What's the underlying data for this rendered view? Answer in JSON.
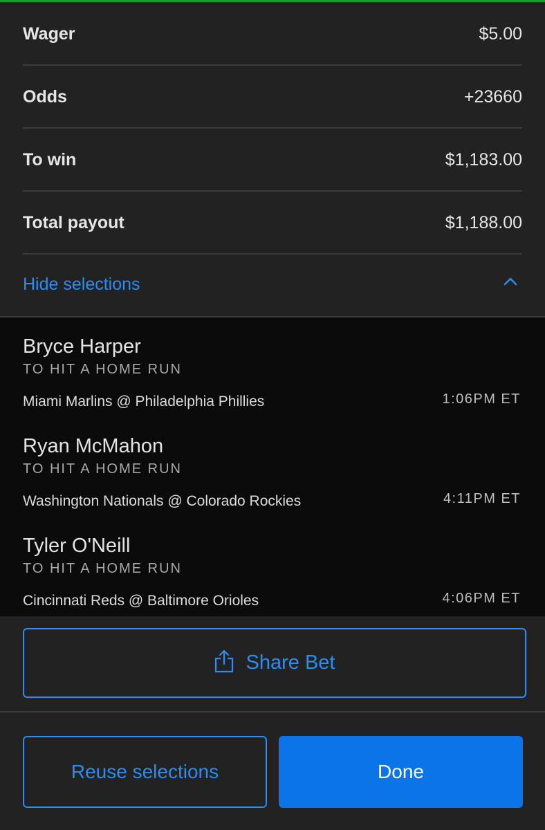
{
  "colors": {
    "accent_top": "#1e9d2a",
    "link_blue": "#2a8cf5",
    "primary_button": "#0b74e8",
    "background": "#222222",
    "selections_background": "#0b0b0b"
  },
  "summary": {
    "wager": {
      "label": "Wager",
      "value": "$5.00"
    },
    "odds": {
      "label": "Odds",
      "value": "+23660"
    },
    "to_win": {
      "label": "To win",
      "value": "$1,183.00"
    },
    "total_payout": {
      "label": "Total payout",
      "value": "$1,188.00"
    }
  },
  "selections_toggle": {
    "label": "Hide selections",
    "icon": "chevron-up-icon"
  },
  "selections": [
    {
      "player": "Bryce Harper",
      "market": "TO HIT A HOME RUN",
      "game": "Miami Marlins @ Philadelphia Phillies",
      "time": "1:06PM ET"
    },
    {
      "player": "Ryan McMahon",
      "market": "TO HIT A HOME RUN",
      "game": "Washington Nationals @ Colorado Rockies",
      "time": "4:11PM ET"
    },
    {
      "player": "Tyler O'Neill",
      "market": "TO HIT A HOME RUN",
      "game": "Cincinnati Reds @ Baltimore Orioles",
      "time": "4:06PM ET"
    }
  ],
  "actions": {
    "share": {
      "label": "Share Bet",
      "icon": "share-icon"
    },
    "reuse": {
      "label": "Reuse selections"
    },
    "done": {
      "label": "Done"
    }
  }
}
